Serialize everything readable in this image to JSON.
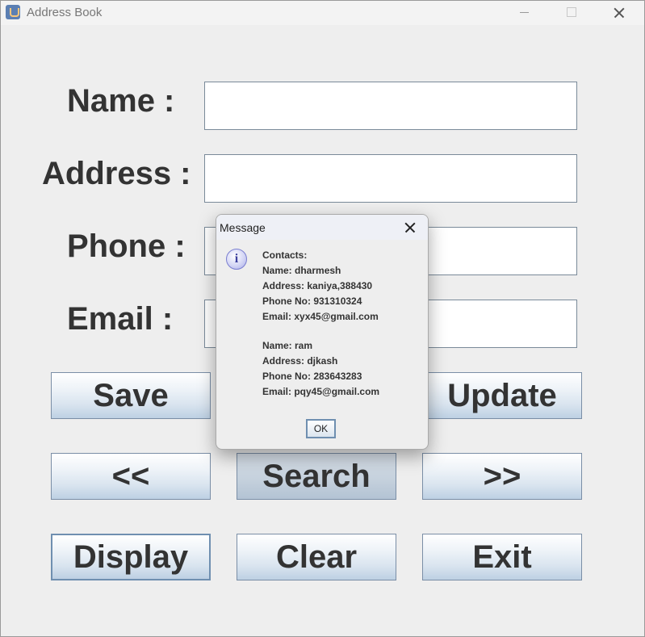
{
  "window": {
    "title": "Address Book"
  },
  "form": {
    "labels": {
      "name": "Name :",
      "address": "Address :",
      "phone": "Phone :",
      "email": "Email :"
    },
    "fields": {
      "name": "",
      "address": "",
      "phone": "",
      "email": ""
    }
  },
  "buttons": {
    "save": "Save",
    "update": "Update",
    "prev": "<<",
    "search": "Search",
    "next": ">>",
    "display": "Display",
    "clear": "Clear",
    "exit": "Exit"
  },
  "dialog": {
    "title": "Message",
    "lines": [
      "Contacts:",
      "Name: dharmesh",
      "Address: kaniya,388430",
      "Phone No: 931310324",
      "Email: xyx45@gmail.com",
      "Name: ram",
      "Address: djkash",
      "Phone No: 283643283",
      "Email: pqy45@gmail.com"
    ],
    "ok_label": "OK",
    "icon": "info-icon"
  },
  "colors": {
    "window_bg": "#eeeeee",
    "button_gradient_bottom": "#bdd0e3",
    "label_text": "#333333",
    "info_icon": "#7a7ed0"
  }
}
